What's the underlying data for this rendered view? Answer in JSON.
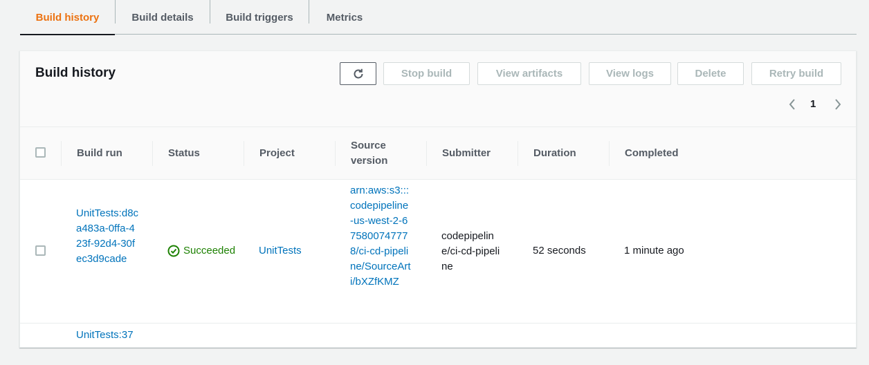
{
  "tabs": [
    {
      "label": "Build history",
      "active": true
    },
    {
      "label": "Build details",
      "active": false
    },
    {
      "label": "Build triggers",
      "active": false
    },
    {
      "label": "Metrics",
      "active": false
    }
  ],
  "panel": {
    "title": "Build history",
    "buttons": {
      "refresh_icon": "refresh-icon",
      "stop": "Stop build",
      "artifacts": "View artifacts",
      "logs": "View logs",
      "delete": "Delete",
      "retry": "Retry build"
    },
    "pagination": {
      "page": "1"
    }
  },
  "table": {
    "columns": [
      "Build run",
      "Status",
      "Project",
      "Source version",
      "Submitter",
      "Duration",
      "Completed"
    ],
    "rows": [
      {
        "build_run": "UnitTests:d8ca483a-0ffa-423f-92d4-30fec3d9cade",
        "status": "Succeeded",
        "project": "UnitTests",
        "source_version": "arn:aws:s3:::codepipeline-us-west-2-675800747778/ci-cd-pipeline/SourceArti/bXZfKMZ",
        "submitter": "codepipeline/ci-cd-pipeline",
        "duration": "52 seconds",
        "completed": "1 minute ago"
      },
      {
        "build_run": "UnitTests:37"
      }
    ]
  },
  "colors": {
    "accent": "#ec7211",
    "link": "#0073bb",
    "success": "#1d8102"
  }
}
